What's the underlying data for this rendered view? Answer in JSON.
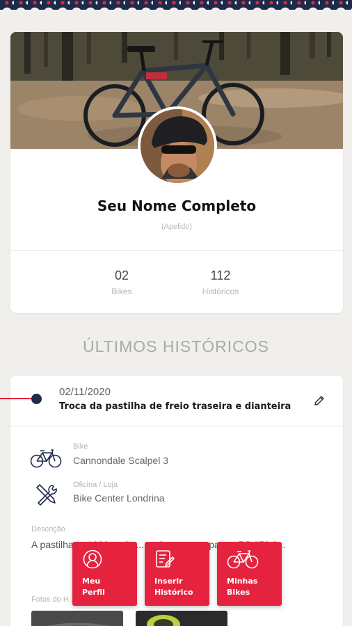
{
  "profile": {
    "name": "Seu Nome Completo",
    "nickname": "(Apelido)",
    "stats": [
      {
        "value": "02",
        "label": "Bikes"
      },
      {
        "value": "112",
        "label": "Históricos"
      }
    ]
  },
  "section_title": "ÚLTIMOS HISTÓRICOS",
  "history": {
    "date": "02/11/2020",
    "title": "Troca da pastilha de freio traseira e dianteira",
    "bike_label": "Bike",
    "bike_value": "Cannondale Scalpel 3",
    "shop_label": "Oficina / Loja",
    "shop_value": "Bike Center Londrina",
    "description_label": "Descrição",
    "description": "A pastilha ... 1000 ... da ... cada por uma past... R$ 170,0...",
    "photos_label": "Fotos do H..."
  },
  "fabs": [
    {
      "label": "Meu\nPerfil",
      "icon": "user-icon"
    },
    {
      "label": "Inserir\nHistórico",
      "icon": "edit-list-icon"
    },
    {
      "label": "Minhas\nBikes",
      "icon": "bike-icon"
    }
  ],
  "colors": {
    "accent": "#e5233f",
    "navy": "#1e2a4a",
    "background": "#f1efec"
  }
}
